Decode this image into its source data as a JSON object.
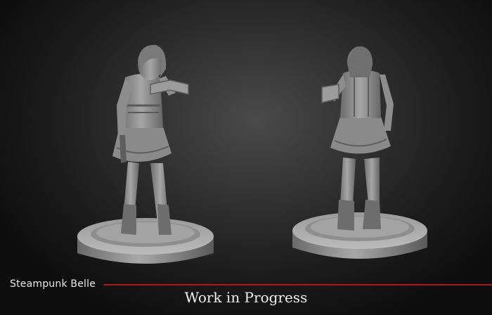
{
  "title": "Steampunk Belle",
  "subtitle": "Work in Progress",
  "colors": {
    "accent_line": "#b3161a",
    "background": "#2a2a2a",
    "model": "#8c8c8c",
    "text": "#f0f0f0"
  },
  "views": [
    "front-figure",
    "back-figure"
  ]
}
